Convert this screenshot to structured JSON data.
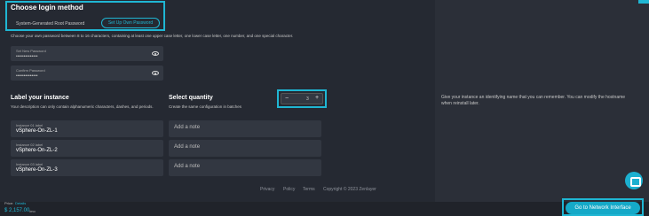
{
  "login": {
    "title": "Choose login method",
    "option1": "System-Generated Root Password",
    "option2": "Set Up Own Password",
    "description": "Choose your own password between 8 to 16 characters, containing at least one upper case letter, one lower case letter, one number, and one special character."
  },
  "password": {
    "set_label": "Set New Password",
    "set_value": "••••••••••••••",
    "confirm_label": "Confirm Password",
    "confirm_value": "••••••••••••••"
  },
  "instance": {
    "title": "Label your instance",
    "description": "Your description can only contain alphanumeric characters, dashes, and periods.",
    "items": [
      {
        "label": "Instance 01 label",
        "value": "vSphere-On-ZL-1",
        "note": "Add a note"
      },
      {
        "label": "Instance 02 label",
        "value": "vSphere-On-ZL-2",
        "note": "Add a note"
      },
      {
        "label": "Instance 03 label",
        "value": "vSphere-On-ZL-3",
        "note": "Add a note"
      }
    ]
  },
  "quantity": {
    "title": "Select quantity",
    "description": "Create the same configuration in batches",
    "value": "3",
    "minus": "−",
    "plus": "+"
  },
  "side_help": "Give your instance an identifying name that you can remember. You can modify the hostname when reinstall later.",
  "footer": {
    "links": [
      "Privacy",
      "Policy",
      "Terms"
    ],
    "copyright": "Copyright © 2023 Zenlayer"
  },
  "price": {
    "label": "Price:",
    "details": "Details",
    "amount": "$ 2,157.00",
    "unit": "/mo"
  },
  "cta": "Go to Network Interface",
  "colors": {
    "accent": "#1fb6d3",
    "background": "#20232a",
    "panel": "#252932"
  }
}
